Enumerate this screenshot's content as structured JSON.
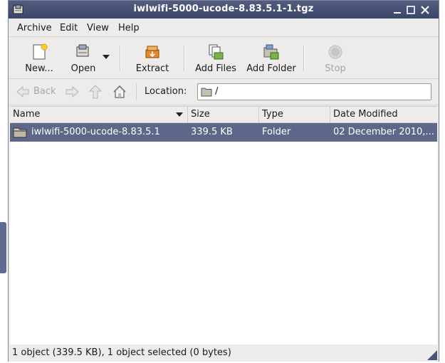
{
  "window": {
    "title": "iwlwifi-5000-ucode-8.83.5.1-1.tgz"
  },
  "menubar": {
    "items": [
      "Archive",
      "Edit",
      "View",
      "Help"
    ]
  },
  "toolbar": {
    "new_label": "New...",
    "open_label": "Open",
    "extract_label": "Extract",
    "add_files_label": "Add Files",
    "add_folder_label": "Add Folder",
    "stop_label": "Stop"
  },
  "location": {
    "back_label": "Back",
    "label": "Location:",
    "value": "/"
  },
  "columns": [
    "Name",
    "Size",
    "Type",
    "Date Modified"
  ],
  "rows": [
    {
      "name": "iwlwifi-5000-ucode-8.83.5.1",
      "size": "339.5 KB",
      "type": "Folder",
      "date": "02 December 2010,..."
    }
  ],
  "status": "1 object (339.5 KB), 1 object selected (0 bytes)",
  "colors": {
    "titlebar": "#48537a",
    "selection": "#5c6789"
  }
}
